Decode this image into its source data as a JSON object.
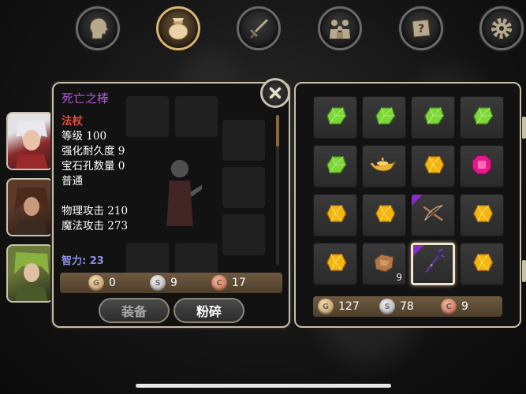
{
  "tabs": [
    {
      "icon": "head-profile-icon",
      "active": false
    },
    {
      "icon": "bag-icon",
      "active": true
    },
    {
      "icon": "sword-icon",
      "active": false
    },
    {
      "icon": "family-icon",
      "active": false
    },
    {
      "icon": "quest-scroll-icon",
      "active": false
    },
    {
      "icon": "gear-icon",
      "active": false
    }
  ],
  "heroes": [
    "white-haired-warrior",
    "brown-haired-rogue",
    "green-haired-elf"
  ],
  "item_detail": {
    "name": "死亡之棒",
    "type": "法杖",
    "level": "等级 100",
    "durability": "强化耐久度 9",
    "sockets": "宝石孔数量 0",
    "quality": "普通",
    "physical_attack": "物理攻击 210",
    "magic_attack": "魔法攻击 273",
    "attribute": "智力: 23",
    "cost": {
      "gold": "0",
      "silver": "9",
      "copper": "17"
    }
  },
  "buttons": {
    "equip": "装备",
    "smash": "粉碎"
  },
  "inventory": {
    "slots": [
      {
        "item": "green-gem"
      },
      {
        "item": "green-gem"
      },
      {
        "item": "green-gem"
      },
      {
        "item": "green-gem"
      },
      {
        "item": "green-gem"
      },
      {
        "item": "magic-lamp"
      },
      {
        "item": "yellow-gem"
      },
      {
        "item": "pink-gem"
      },
      {
        "item": "yellow-gem"
      },
      {
        "item": "yellow-gem"
      },
      {
        "item": "crossbow",
        "rare": true
      },
      {
        "item": "yellow-gem"
      },
      {
        "item": "yellow-gem"
      },
      {
        "item": "leather-hide",
        "count": "9"
      },
      {
        "item": "death-staff",
        "rare": true,
        "selected": true
      },
      {
        "item": "yellow-gem"
      }
    ],
    "currency": {
      "gold": "127",
      "silver": "78",
      "copper": "9"
    }
  },
  "colors": {
    "item_name": "#b05ad8",
    "item_type": "#e84a3c",
    "attribute": "#8f8fe6",
    "panel_border": "#c7bfa9",
    "active_tab": "#d9b572"
  }
}
